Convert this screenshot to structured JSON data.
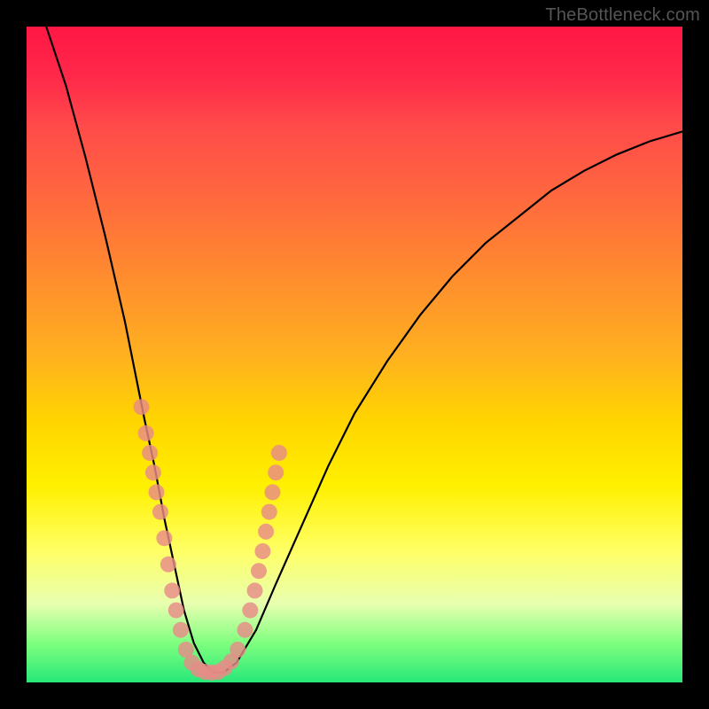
{
  "watermark": "TheBottleneck.com",
  "chart_data": {
    "type": "line",
    "title": "",
    "xlabel": "",
    "ylabel": "",
    "xlim": [
      0,
      100
    ],
    "ylim": [
      0,
      100
    ],
    "legend": false,
    "background": "rainbow-vertical-gradient",
    "series": [
      {
        "name": "bottleneck-curve",
        "x": [
          0,
          3,
          6,
          9,
          12,
          15,
          18,
          19.5,
          21,
          22.5,
          24,
          25.5,
          27,
          28.5,
          30,
          32,
          35,
          38,
          42,
          46,
          50,
          55,
          60,
          65,
          70,
          75,
          80,
          85,
          90,
          95,
          100
        ],
        "y": [
          108,
          100,
          91,
          80,
          68,
          55,
          40,
          33,
          25,
          18,
          11,
          6,
          3,
          1.5,
          1.5,
          3,
          8,
          15,
          24,
          33,
          41,
          49,
          56,
          62,
          67,
          71,
          75,
          78,
          80.5,
          82.5,
          84
        ]
      }
    ],
    "markers": {
      "name": "sample-dots",
      "points": [
        {
          "x": 17.5,
          "y": 42
        },
        {
          "x": 18.2,
          "y": 38
        },
        {
          "x": 18.8,
          "y": 35
        },
        {
          "x": 19.3,
          "y": 32
        },
        {
          "x": 19.8,
          "y": 29
        },
        {
          "x": 20.4,
          "y": 26
        },
        {
          "x": 21.0,
          "y": 22
        },
        {
          "x": 21.6,
          "y": 18
        },
        {
          "x": 22.2,
          "y": 14
        },
        {
          "x": 22.8,
          "y": 11
        },
        {
          "x": 23.5,
          "y": 8
        },
        {
          "x": 24.3,
          "y": 5
        },
        {
          "x": 25.2,
          "y": 3
        },
        {
          "x": 26.2,
          "y": 2
        },
        {
          "x": 27.2,
          "y": 1.6
        },
        {
          "x": 28.2,
          "y": 1.5
        },
        {
          "x": 29.2,
          "y": 1.6
        },
        {
          "x": 30.2,
          "y": 2.2
        },
        {
          "x": 31.2,
          "y": 3.2
        },
        {
          "x": 32.2,
          "y": 5
        },
        {
          "x": 33.3,
          "y": 8
        },
        {
          "x": 34.1,
          "y": 11
        },
        {
          "x": 34.8,
          "y": 14
        },
        {
          "x": 35.4,
          "y": 17
        },
        {
          "x": 36.0,
          "y": 20
        },
        {
          "x": 36.5,
          "y": 23
        },
        {
          "x": 37.0,
          "y": 26
        },
        {
          "x": 37.5,
          "y": 29
        },
        {
          "x": 38.0,
          "y": 32
        },
        {
          "x": 38.5,
          "y": 35
        }
      ]
    }
  }
}
